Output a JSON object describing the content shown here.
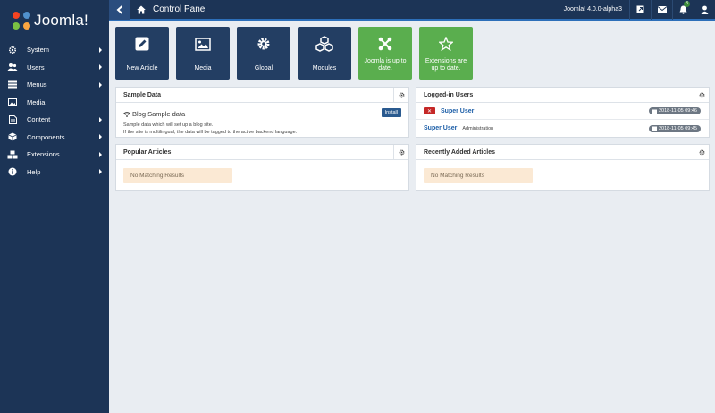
{
  "brand": {
    "name": "Joomla!"
  },
  "sidebar": {
    "items": [
      {
        "label": "System",
        "icon": "gear-icon",
        "has_submenu": true
      },
      {
        "label": "Users",
        "icon": "users-icon",
        "has_submenu": true
      },
      {
        "label": "Menus",
        "icon": "list-icon",
        "has_submenu": true
      },
      {
        "label": "Media",
        "icon": "image-icon",
        "has_submenu": false
      },
      {
        "label": "Content",
        "icon": "file-icon",
        "has_submenu": true
      },
      {
        "label": "Components",
        "icon": "cube-icon",
        "has_submenu": true
      },
      {
        "label": "Extensions",
        "icon": "cubes-icon",
        "has_submenu": true
      },
      {
        "label": "Help",
        "icon": "info-icon",
        "has_submenu": true
      }
    ]
  },
  "header": {
    "title": "Control Panel",
    "version": "Joomla! 4.0.0-alpha3",
    "notification_count": "3"
  },
  "quickicons": [
    {
      "label": "New Article",
      "icon": "pencil-icon",
      "style": "dark"
    },
    {
      "label": "Media",
      "icon": "image-icon",
      "style": "dark"
    },
    {
      "label": "Global",
      "icon": "gear-icon",
      "style": "dark"
    },
    {
      "label": "Modules",
      "icon": "cubes-icon",
      "style": "dark"
    },
    {
      "label": "Joomla is up to date.",
      "icon": "joomla-icon",
      "style": "green"
    },
    {
      "label": "Extensions are up to date.",
      "icon": "star-icon",
      "style": "green"
    }
  ],
  "panels": {
    "sample_data": {
      "title": "Sample Data",
      "item_title": "Blog Sample data",
      "desc_line1": "Sample data which will set up a blog site.",
      "desc_line2": "If the site is multilingual, the data will be tagged to the active backend language.",
      "install_label": "Install"
    },
    "logged_in": {
      "title": "Logged-in Users",
      "users": [
        {
          "name": "Super User",
          "role": "",
          "date": "2018-11-05 09:46",
          "logout": true
        },
        {
          "name": "Super User",
          "role": "Administration",
          "date": "2018-11-05 09:45",
          "logout": false
        }
      ]
    },
    "popular": {
      "title": "Popular Articles",
      "empty": "No Matching Results"
    },
    "recent": {
      "title": "Recently Added Articles",
      "empty": "No Matching Results"
    }
  },
  "colors": {
    "sidebar_bg": "#1c3456",
    "quickicon_dark": "#233e63",
    "quickicon_green": "#5aae4e",
    "accent": "#2d6fb9"
  }
}
